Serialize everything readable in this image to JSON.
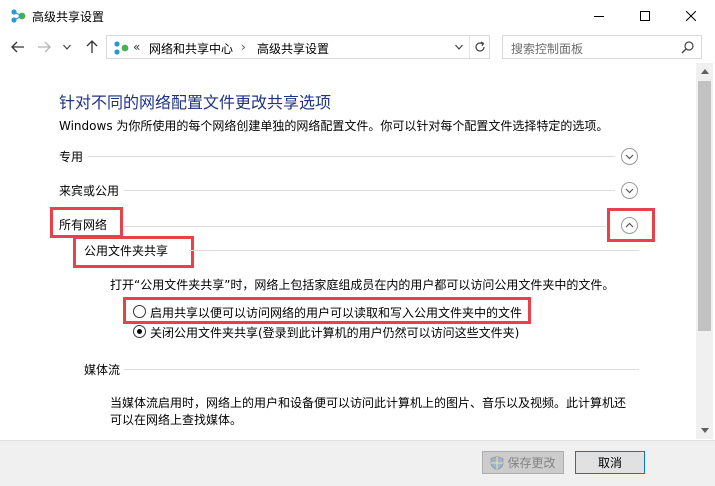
{
  "window": {
    "title": "高级共享设置",
    "controls": {
      "minimize_icon": "minimize-icon",
      "maximize_icon": "maximize-icon",
      "close_icon": "close-icon"
    }
  },
  "address_bar": {
    "back_icon": "back-arrow-icon",
    "forward_icon": "forward-arrow-icon",
    "recent_icon": "chevron-down-icon",
    "up_icon": "up-arrow-icon",
    "overflow": "«",
    "breadcrumbs": [
      "网络和共享中心",
      "高级共享设置"
    ],
    "separator": "›",
    "search_placeholder": "搜索控制面板"
  },
  "main": {
    "heading": "针对不同的网络配置文件更改共享选项",
    "description": "Windows 为你所使用的每个网络创建单独的网络配置文件。你可以针对每个配置文件选择特定的选项。",
    "profiles": [
      {
        "label": "专用",
        "state": "collapsed"
      },
      {
        "label": "来宾或公用",
        "state": "collapsed"
      },
      {
        "label": "所有网络",
        "state": "expanded"
      }
    ],
    "public_folder": {
      "title": "公用文件夹共享",
      "description": "打开“公用文件夹共享”时，网络上包括家庭组成员在内的用户都可以访问公用文件夹中的文件。",
      "options": [
        {
          "label": "启用共享以便可以访问网络的用户可以读取和写入公用文件夹中的文件",
          "selected": false
        },
        {
          "label": "关闭公用文件夹共享(登录到此计算机的用户仍然可以访问这些文件夹)",
          "selected": true
        }
      ]
    },
    "media": {
      "title": "媒体流",
      "description_line1": "当媒体流启用时，网络上的用户和设备便可以访问此计算机上的图片、音乐以及视频。此计算机还",
      "description_line2": "可以在网络上查找媒体。"
    }
  },
  "footer": {
    "save_label": "保存更改",
    "cancel_label": "取消"
  },
  "colors": {
    "heading": "#1e3287",
    "highlight": "#e8414a",
    "accent": "#0078d7"
  }
}
